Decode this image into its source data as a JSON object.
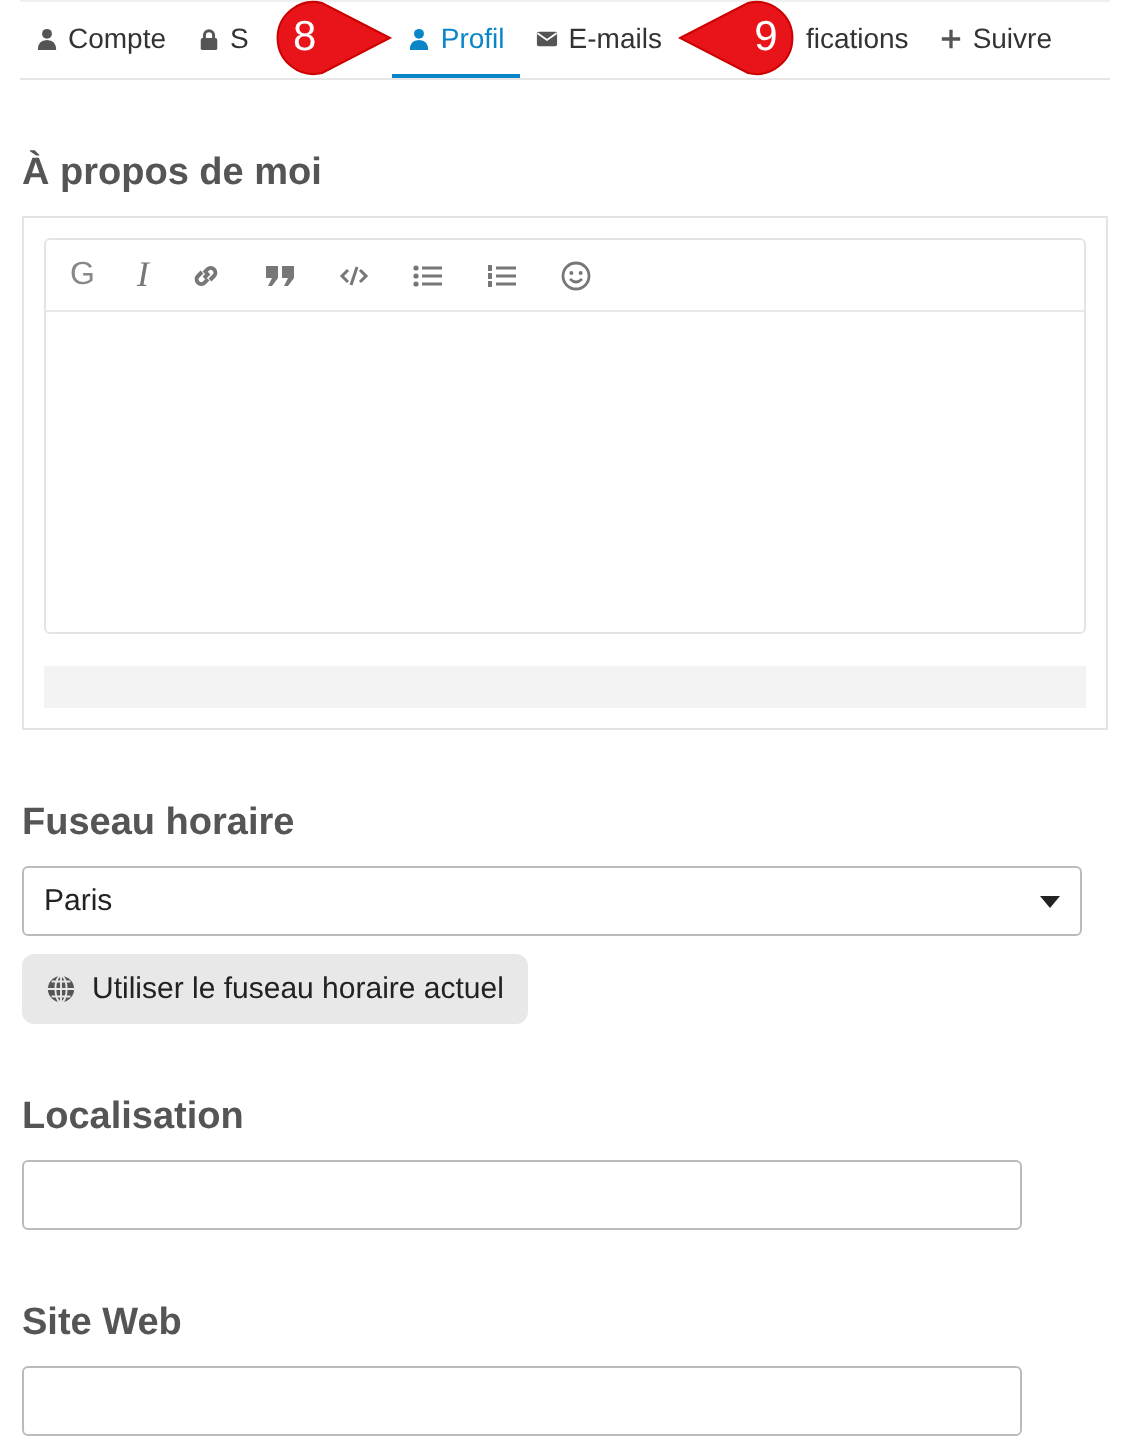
{
  "tabs": [
    {
      "label": "Compte",
      "selected": false
    },
    {
      "label": "S",
      "selected": false
    },
    {
      "label": "Profil",
      "selected": true
    },
    {
      "label": "E-mails",
      "selected": false
    },
    {
      "label": "fications",
      "selected": false
    },
    {
      "label": "Suivre",
      "selected": false
    }
  ],
  "callouts": [
    {
      "label": "8"
    },
    {
      "label": "9"
    }
  ],
  "about": {
    "heading": "À propos de moi",
    "toolbar": {
      "bold_label": "G",
      "italic_label": "I"
    }
  },
  "timezone": {
    "heading": "Fuseau horaire",
    "value": "Paris",
    "button": "Utiliser le fuseau horaire actuel"
  },
  "location": {
    "heading": "Localisation"
  },
  "website": {
    "heading": "Site Web"
  }
}
